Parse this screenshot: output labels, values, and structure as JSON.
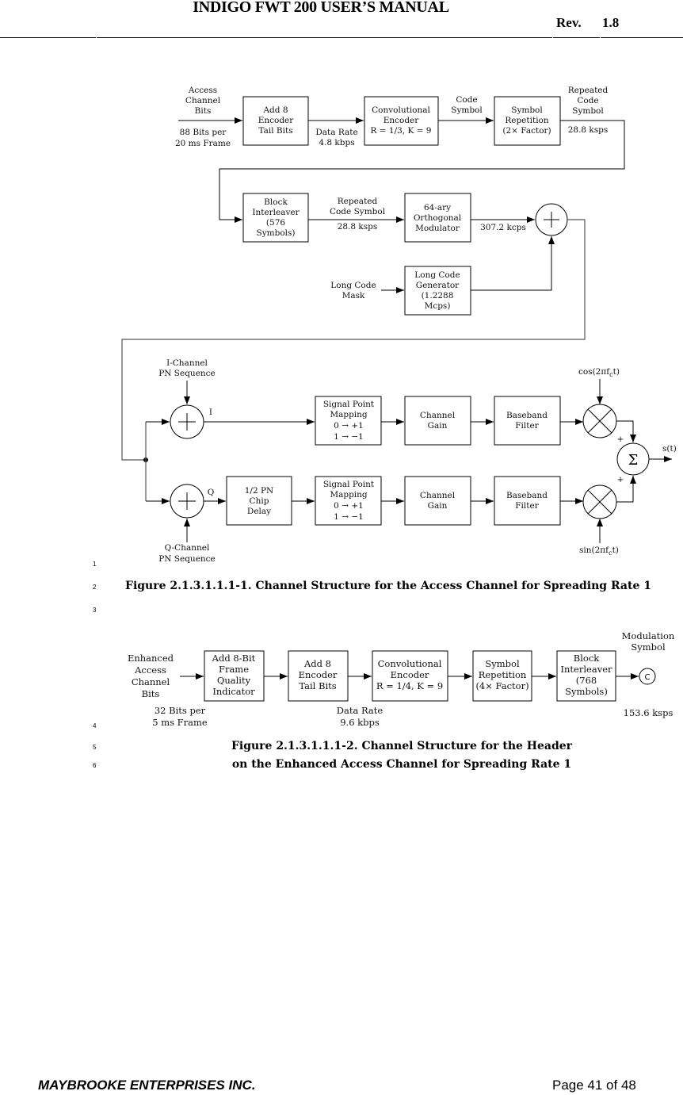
{
  "header": {
    "title": "INDIGO FWT 200 USER’S MANUAL",
    "rev_label": "Rev.",
    "rev_value": "1.8"
  },
  "line_numbers": [
    "1",
    "2",
    "3",
    "4",
    "5",
    "6"
  ],
  "figure1": {
    "caption": "Figure 2.1.3.1.1.1-1. Channel Structure for the Access Channel for Spreading Rate 1",
    "input_label": [
      "Access",
      "Channel",
      "Bits"
    ],
    "input_rate": [
      "88 Bits per",
      "20 ms Frame"
    ],
    "blocks": {
      "tail_bits": [
        "Add 8",
        "Encoder",
        "Tail Bits"
      ],
      "conv_encoder": [
        "Convolutional",
        "Encoder",
        "R = 1/3, K = 9"
      ],
      "symbol_repetition": [
        "Symbol",
        "Repetition",
        "(2× Factor)"
      ],
      "block_interleaver": [
        "Block",
        "Interleaver",
        "(576",
        "Symbols)"
      ],
      "orthogonal_modulator": [
        "64-ary",
        "Orthogonal",
        "Modulator"
      ],
      "long_code_generator": [
        "Long Code",
        "Generator",
        "(1.2288",
        "Mcps)"
      ],
      "i_mapping": [
        "Signal Point",
        "Mapping",
        "0 → +1",
        "1 → −1"
      ],
      "q_mapping": [
        "Signal Point",
        "Mapping",
        "0 → +1",
        "1 → −1"
      ],
      "pn_delay": [
        "1/2 PN",
        "Chip",
        "Delay"
      ],
      "i_gain": [
        "Channel",
        "Gain"
      ],
      "q_gain": [
        "Channel",
        "Gain"
      ],
      "i_filter": [
        "Baseband",
        "Filter"
      ],
      "q_filter": [
        "Baseband",
        "Filter"
      ]
    },
    "labels": {
      "data_rate": [
        "Data Rate",
        "4.8 kbps"
      ],
      "code_symbol": [
        "Code",
        "Symbol"
      ],
      "repeated_code_symbol": [
        "Repeated",
        "Code",
        "Symbol"
      ],
      "repeated_rate": "28.8 ksps",
      "interleaver_out": [
        "Repeated",
        "Code Symbol"
      ],
      "interleaver_rate": "28.8 ksps",
      "modulator_rate": "307.2 kcps",
      "long_code_mask": [
        "Long Code",
        "Mask"
      ],
      "i_pn": [
        "I-Channel",
        "PN Sequence"
      ],
      "q_pn": [
        "Q-Channel",
        "PN Sequence"
      ],
      "i": "I",
      "q": "Q",
      "cos": "cos(2πf",
      "sin": "sin(2πf",
      "carrier_sub": "c",
      "carrier_tail": "t)",
      "plus": "+",
      "sigma": "Σ",
      "output": "s(t)"
    }
  },
  "figure2": {
    "caption_line1": "Figure 2.1.3.1.1.1-2. Channel Structure for the Header",
    "caption_line2": "on the Enhanced Access Channel for Spreading Rate 1",
    "input_label": [
      "Enhanced",
      "Access",
      "Channel",
      "Bits"
    ],
    "input_rate": [
      "32 Bits per",
      "5 ms Frame"
    ],
    "data_rate": [
      "Data Rate",
      "9.6 kbps"
    ],
    "blocks": {
      "frame_quality": [
        "Add 8-Bit",
        "Frame",
        "Quality",
        "Indicator"
      ],
      "tail_bits": [
        "Add 8",
        "Encoder",
        "Tail Bits"
      ],
      "conv_encoder": [
        "Convolutional",
        "Encoder",
        "R = 1/4, K = 9"
      ],
      "symbol_repetition": [
        "Symbol",
        "Repetition",
        "(4× Factor)"
      ],
      "block_interleaver": [
        "Block",
        "Interleaver",
        "(768",
        "Symbols)"
      ]
    },
    "output_label": [
      "Modulation",
      "Symbol"
    ],
    "output_node": "C",
    "output_rate": "153.6 ksps"
  },
  "footer": {
    "company": "MAYBROOKE ENTERPRISES INC.",
    "page": "Page 41 of 48"
  }
}
